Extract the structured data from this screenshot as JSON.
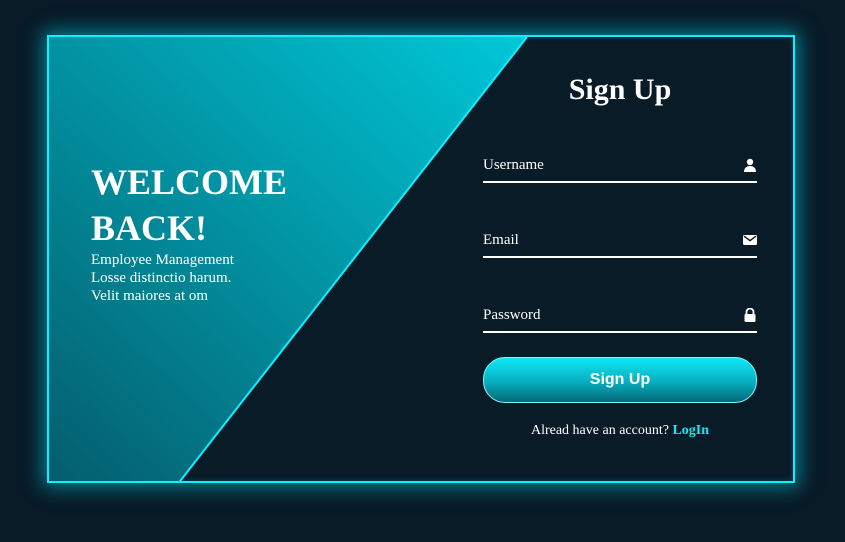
{
  "left_panel": {
    "heading": "WELCOME BACK!",
    "description": "Employee Management Losse distinctio harum. Velit maiores at om"
  },
  "form": {
    "title": "Sign Up",
    "fields": [
      {
        "label": "Username",
        "icon": "user-icon"
      },
      {
        "label": "Email",
        "icon": "mail-icon"
      },
      {
        "label": "Password",
        "icon": "lock-icon"
      }
    ],
    "submit_label": "Sign Up",
    "footer_text": "Alread have an account?",
    "footer_link": "LogIn"
  },
  "colors": {
    "background": "#081b27",
    "accent": "#0ef0ff",
    "link": "#19e6f5",
    "panel_gradient_light": "#00c8d8",
    "panel_gradient_dark": "#045d6d"
  }
}
